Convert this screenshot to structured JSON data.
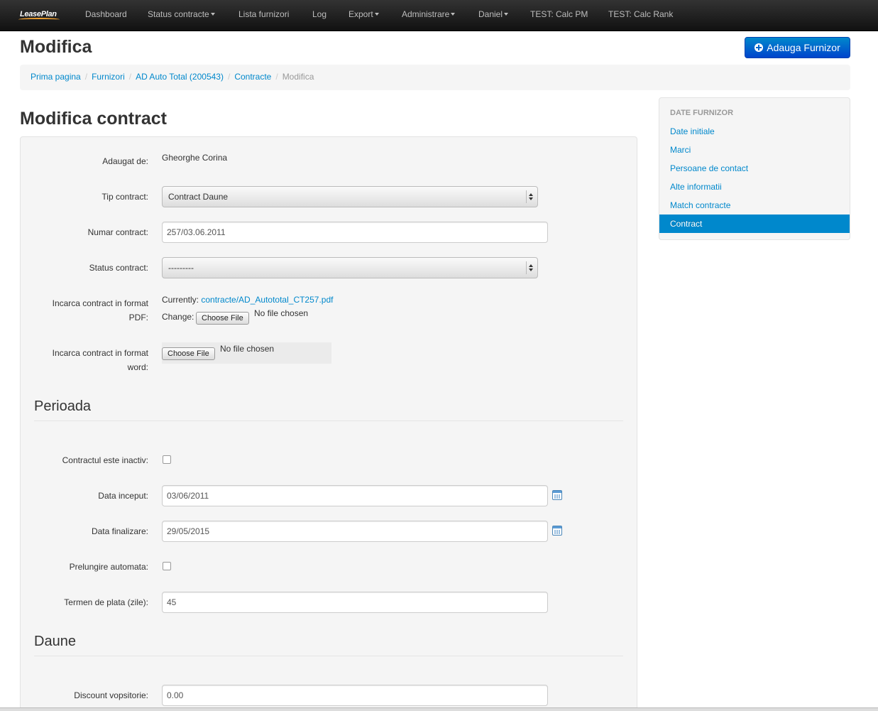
{
  "brand": {
    "logo_text": "LeasePlan"
  },
  "nav": {
    "items": [
      {
        "label": "Dashboard",
        "dropdown": false
      },
      {
        "label": "Status contracte",
        "dropdown": true
      },
      {
        "label": "Lista furnizori",
        "dropdown": false
      },
      {
        "label": "Log",
        "dropdown": false
      },
      {
        "label": "Export",
        "dropdown": true
      },
      {
        "label": "Administrare",
        "dropdown": true
      },
      {
        "label": "Daniel",
        "dropdown": true
      },
      {
        "label": "TEST: Calc PM",
        "dropdown": false
      },
      {
        "label": "TEST: Calc Rank",
        "dropdown": false
      }
    ]
  },
  "header": {
    "title": "Modifica",
    "add_button_label": "Adauga Furnizor",
    "add_button_icon": "plus-circle-icon"
  },
  "breadcrumb": {
    "items": [
      "Prima pagina",
      "Furnizori",
      "AD Auto Total (200543)",
      "Contracte"
    ],
    "separator": "/",
    "active": "Modifica"
  },
  "form": {
    "title": "Modifica contract",
    "added_by": {
      "label": "Adaugat de:",
      "value": "Gheorghe Corina"
    },
    "tip_contract": {
      "label": "Tip contract:",
      "selected": "Contract Daune"
    },
    "numar_contract": {
      "label": "Numar contract:",
      "value": "257/03.06.2011"
    },
    "status_contract": {
      "label": "Status contract:",
      "selected": "---------"
    },
    "pdf_upload": {
      "label_line1": "Incarca contract in format",
      "label_line2": "PDF:",
      "currently_label": "Currently:",
      "current_file": "contracte/AD_Autototal_CT257.pdf",
      "change_label": "Change:",
      "button_label": "Choose File",
      "status": "No file chosen"
    },
    "word_upload": {
      "label_line1": "Incarca contract in format",
      "label_line2": "word:",
      "button_label": "Choose File",
      "status": "No file chosen"
    },
    "perioada": {
      "legend": "Perioada",
      "inactive": {
        "label": "Contractul este inactiv:",
        "checked": false
      },
      "data_inceput": {
        "label": "Data inceput:",
        "value": "03/06/2011"
      },
      "data_finalizare": {
        "label": "Data finalizare:",
        "value": "29/05/2015"
      },
      "prelungire": {
        "label": "Prelungire automata:",
        "checked": false
      },
      "termen_plata": {
        "label": "Termen de plata (zile):",
        "value": "45"
      }
    },
    "daune": {
      "legend": "Daune",
      "discount_vopsitorie": {
        "label": "Discount vopsitorie:",
        "value": "0.00"
      }
    }
  },
  "sidebar": {
    "header": "DATE FURNIZOR",
    "items": [
      "Date initiale",
      "Marci",
      "Persoane de contact",
      "Alte informatii",
      "Match contracte",
      "Contract"
    ],
    "active": "Contract"
  },
  "colors": {
    "accent": "#0088cc",
    "button": "#0055cc",
    "navbar": "#1b1b1b"
  }
}
